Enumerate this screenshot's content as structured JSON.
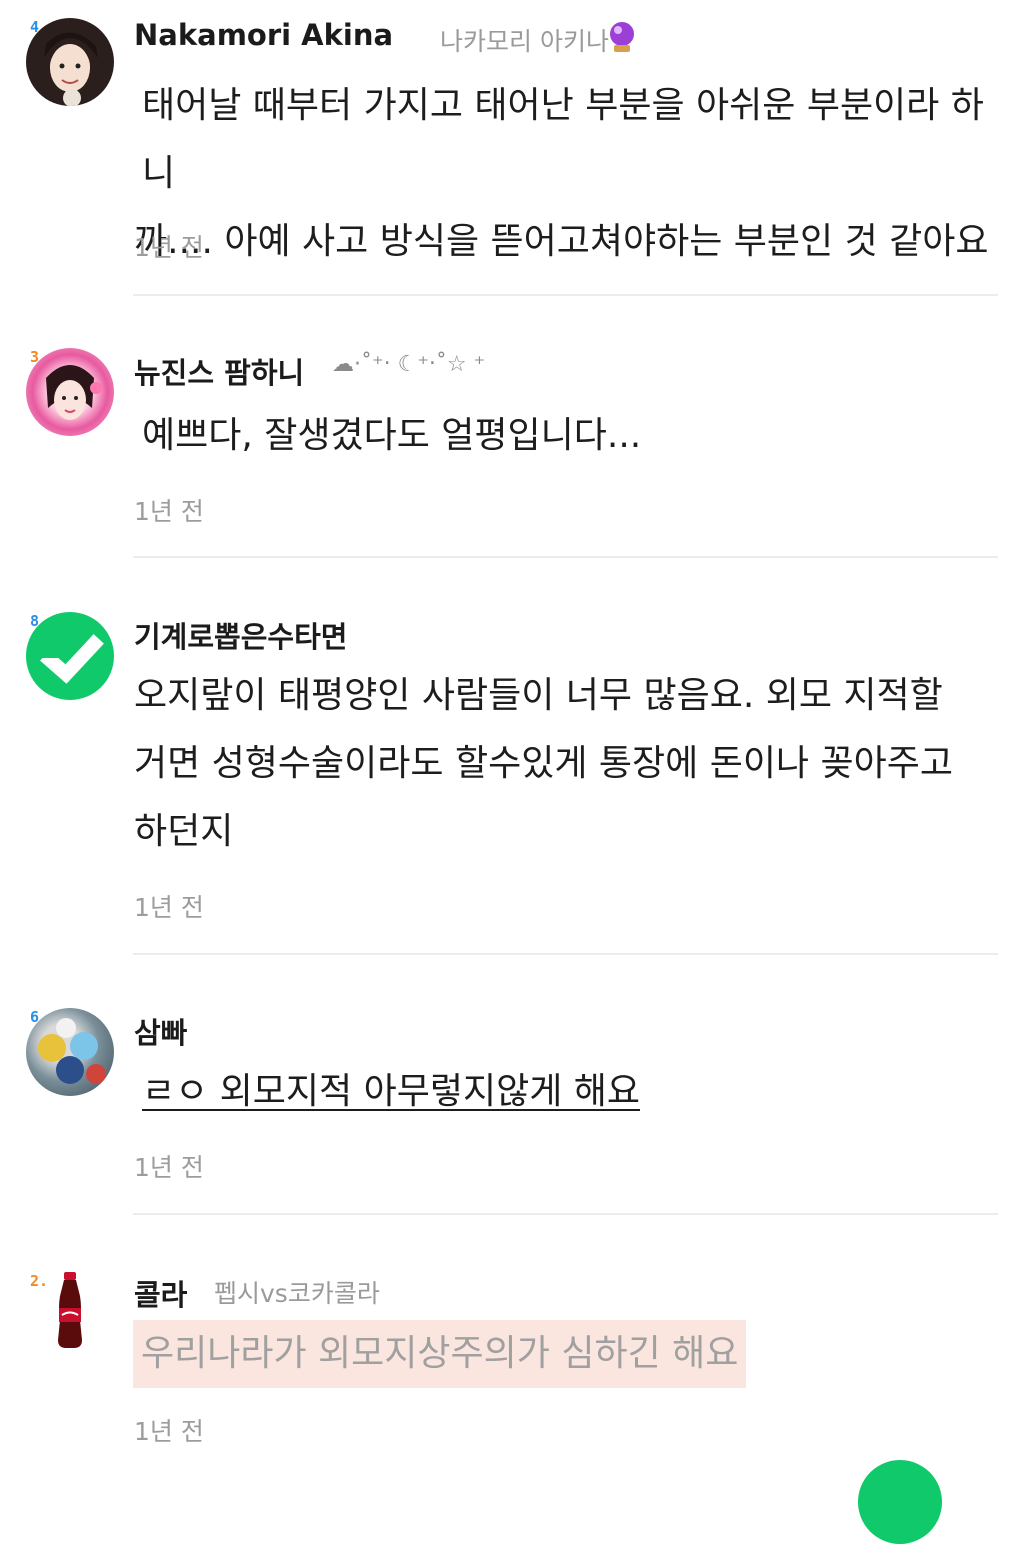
{
  "comments": [
    {
      "level": "4",
      "name": "Nakamori Akina",
      "subtag": "나카모리 아키나",
      "badge_icon": "crystal-ball-icon",
      "text_lines": [
        "태어날 때부터 가지고 태어난 부분을 아쉬운 부분이라 하니",
        "까.... 아예 사고 방식을 뜯어고쳐야하는 부분인 것 같아요"
      ],
      "time": "1년 전"
    },
    {
      "level": "3",
      "name": "뉴진스 팜하니",
      "subtag": "☁·˚⁺‧ ☾⁺‧˚☆ ⁺",
      "text_lines": [
        "예쁘다, 잘생겼다도 얼평입니다..."
      ],
      "time": "1년 전"
    },
    {
      "level": "8",
      "name": "기계로뽑은수타면",
      "text_lines": [
        "오지랖이 태평양인 사람들이 너무 많음요. 외모 지적할",
        "거면 성형수술이라도 할수있게 통장에 돈이나 꽂아주고",
        "하던지"
      ],
      "time": "1년 전"
    },
    {
      "level": "6",
      "name": "삼빠",
      "text_lines": [
        "ㄹㅇ 외모지적 아무렇지않게 해요"
      ],
      "time": "1년 전"
    },
    {
      "level": "2.",
      "name": "콜라",
      "subtag": "펩시vs코카콜라",
      "text_lines": [
        "우리나라가 외모지상주의가 심하긴 해요"
      ],
      "time": "1년 전"
    }
  ],
  "colors": {
    "accent_green": "#10c96a",
    "level_blue": "#2a8fe6",
    "level_orange": "#f08a24",
    "highlight_bg": "#fbe5df"
  }
}
